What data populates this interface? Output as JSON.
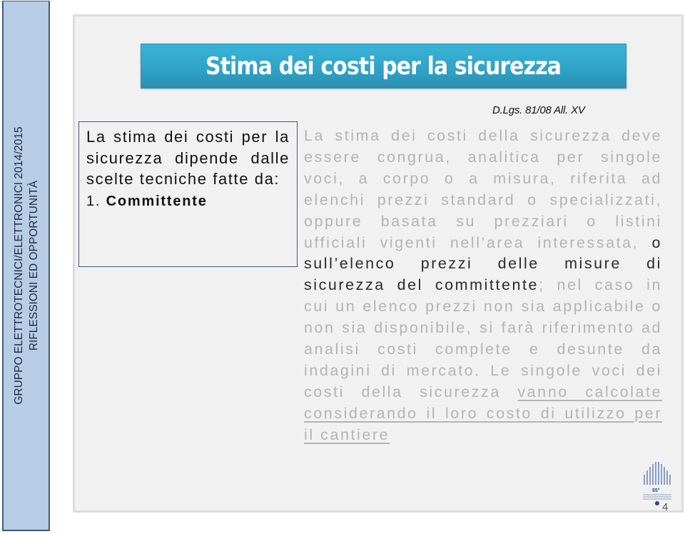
{
  "sidebar": {
    "line1": "GRUPPO ELETTROTECNICI/ELETTRONICI 2014/2015",
    "line2": "RIFLESSIONI ED OPPORTUNITÀ"
  },
  "slide": {
    "title": "Stima dei costi per la sicurezza",
    "reference": "D.Lgs. 81/08  All. XV",
    "left_box": {
      "intro": "La stima dei costi per la sicurezza dipende dalle scelte tecniche fatte da:",
      "item_number": "1.",
      "item_label": "Committente"
    },
    "body": {
      "part1": "La stima dei costi della sicurezza deve essere congrua, analitica per singole voci, a corpo o a misura, riferita ad elenchi prezzi standard o specializzati, oppure basata su prezziari o listini ufficiali vigenti nell’area interessata,",
      "part2_highlight": "o sull’elenco prezzi delle misure di sicurezza del committente",
      "part3": "; nel caso in cui un elenco prezzi non sia applicabile o non sia disponibile, si farà riferimento ad analisi costi complete e desunte da indagini di mercato. Le singole voci dei costi della sicurezza",
      "part4_underlined": "vanno calcolate considerando il loro costo di utilizzo per il cantiere"
    },
    "logo": {
      "icon": "anniversary-logo-icon",
      "badge": "65°"
    },
    "page_number": "4"
  }
}
